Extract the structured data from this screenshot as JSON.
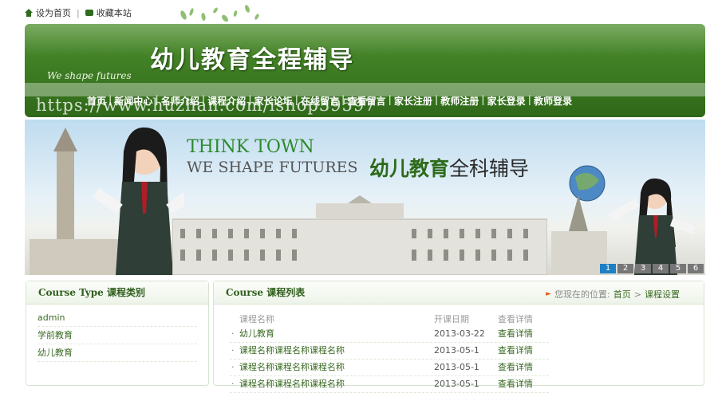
{
  "top": {
    "set_home": "设为首页",
    "favorite": "收藏本站",
    "home_icon": "home-icon",
    "fav_icon": "bookmark-icon"
  },
  "header": {
    "logo": "幼儿教育全程辅导",
    "slogan": "We shape futures",
    "watermark": "https://www.huzhan.com/ishop39597"
  },
  "nav": {
    "items": [
      "首页",
      "新闻中心",
      "名师介绍",
      "课程介绍",
      "家长论坛",
      "在线留言",
      "查看留言",
      "家长注册",
      "教师注册",
      "家长登录",
      "教师登录"
    ]
  },
  "banner": {
    "line1": "THINK TOWN",
    "line2": "WE SHAPE FUTURES",
    "line3_bold": "幼儿教育",
    "line3_rest": "全科辅导",
    "pages": [
      "1",
      "2",
      "3",
      "4",
      "5",
      "6"
    ],
    "active_page": "1"
  },
  "left_panel": {
    "title_en": "Course Type",
    "title_cn": "课程类别",
    "items": [
      "admin",
      "学前教育",
      "幼儿教育"
    ]
  },
  "right_panel": {
    "title_en": "Course",
    "title_cn": "课程列表",
    "crumb_prefix": "您现在的位置:",
    "crumb_home": "首页",
    "crumb_sep": ">",
    "crumb_current": "课程设置",
    "columns": {
      "name": "课程名称",
      "date": "开课日期",
      "view": "查看详情"
    },
    "rows": [
      {
        "name": "幼儿教育",
        "date": "2013-03-22",
        "view": "查看详情"
      },
      {
        "name": "课程名称课程名称课程名称",
        "date": "2013-05-1",
        "view": "查看详情"
      },
      {
        "name": "课程名称课程名称课程名称",
        "date": "2013-05-1",
        "view": "查看详情"
      },
      {
        "name": "课程名称课程名称课程名称",
        "date": "2013-05-1",
        "view": "查看详情"
      }
    ]
  },
  "colors": {
    "brand_green": "#3c7a22",
    "link_green": "#3a6a22",
    "pager_active": "#1d7fc4"
  }
}
